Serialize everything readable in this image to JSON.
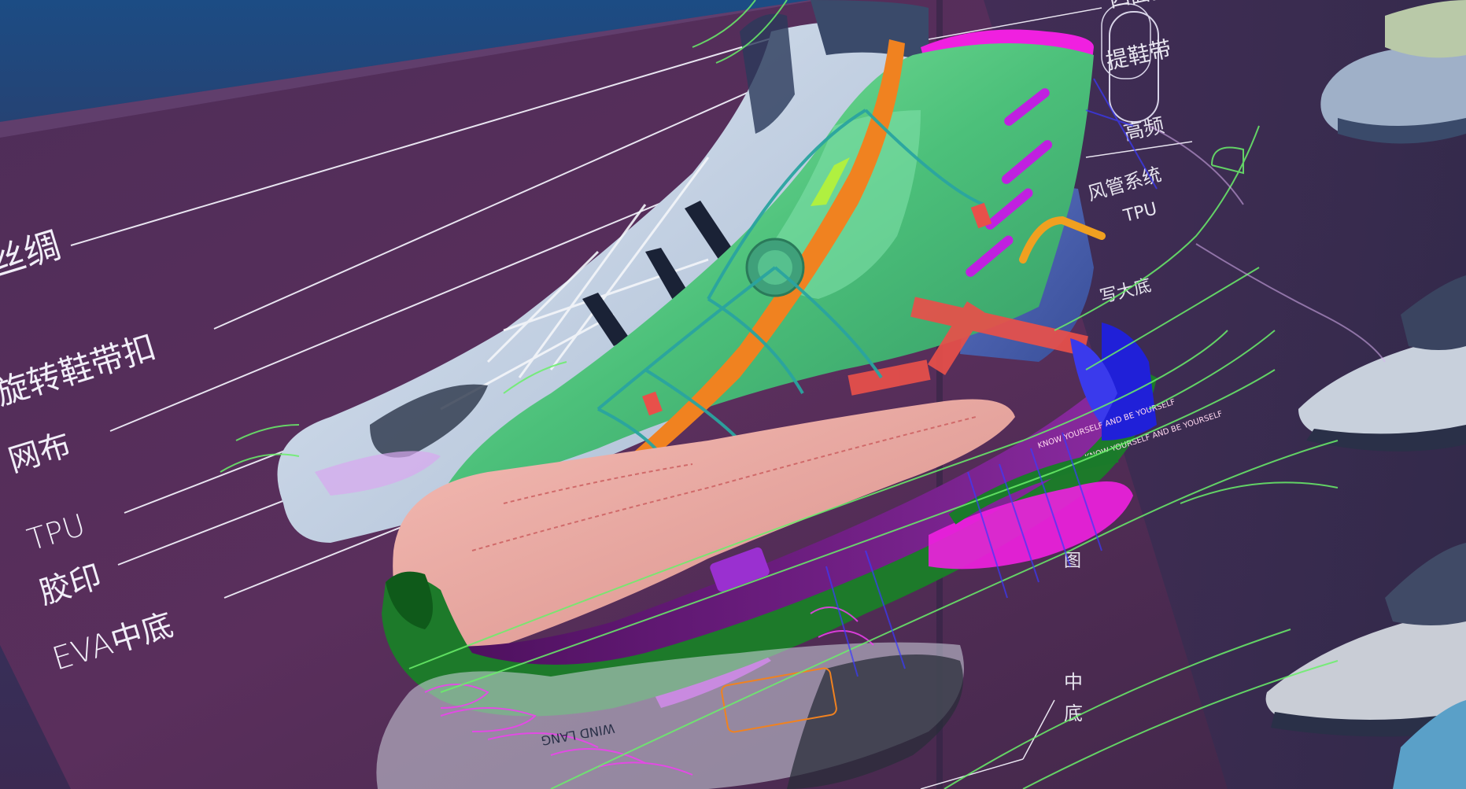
{
  "scene": {
    "caption_colors": {
      "background_top": "#1a4a80",
      "panel": "#4a2b52",
      "panel_right": "#3a2a4e",
      "upper_green": "#5fcf86",
      "toe_cap": "#e9a6a0",
      "outsole_green": "#1d7a2a",
      "midsole_purple": "#6a1d7e",
      "accent_magenta": "#f020e0",
      "accent_orange": "#f08220",
      "accent_red": "#e8504a",
      "wire_green": "#60f060"
    }
  },
  "left_callouts": [
    {
      "label": "丝绸"
    },
    {
      "label": "旋转鞋带扣"
    },
    {
      "label": "网布"
    },
    {
      "label": "TPU"
    },
    {
      "label": "胶印"
    },
    {
      "label": "EVA中底"
    }
  ],
  "right_callouts": [
    {
      "label": "四面弹"
    },
    {
      "label": "提鞋带"
    },
    {
      "label": "高频"
    },
    {
      "label": "风管系统"
    },
    {
      "label": "TPU"
    },
    {
      "label": "写大底"
    },
    {
      "label": "图"
    },
    {
      "label": "中"
    },
    {
      "label": "底"
    }
  ],
  "midsole_text": [
    "KNOW YOURSELF AND BE YOURSELF",
    "KNOW YOURSELF AND BE YOURSELF"
  ],
  "outsole_text": "WIND LANG"
}
